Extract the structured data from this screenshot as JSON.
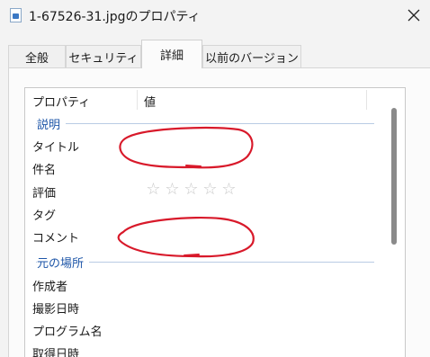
{
  "window": {
    "title": "1-67526-31.jpgのプロパティ",
    "file_icon": "image-file-icon",
    "close_icon": "close-icon"
  },
  "tabs": [
    {
      "label": "全般",
      "active": false
    },
    {
      "label": "セキュリティ",
      "active": false
    },
    {
      "label": "詳細",
      "active": true
    },
    {
      "label": "以前のバージョン",
      "active": false
    }
  ],
  "details": {
    "columns": {
      "property": "プロパティ",
      "value": "値"
    },
    "sections": [
      {
        "label": "説明",
        "rows": [
          "タイトル",
          "件名",
          "評価",
          "タグ",
          "コメント"
        ]
      },
      {
        "label": "元の場所",
        "rows": [
          "作成者",
          "撮影日時",
          "プログラム名",
          "取得日時"
        ]
      }
    ],
    "rating": {
      "stars_filled": 0,
      "stars_total": 5,
      "star_glyph": "☆"
    }
  },
  "colors": {
    "section_text": "#1e56a8",
    "annotation_red": "#d8192a",
    "window_bg": "#f3f3f3"
  }
}
